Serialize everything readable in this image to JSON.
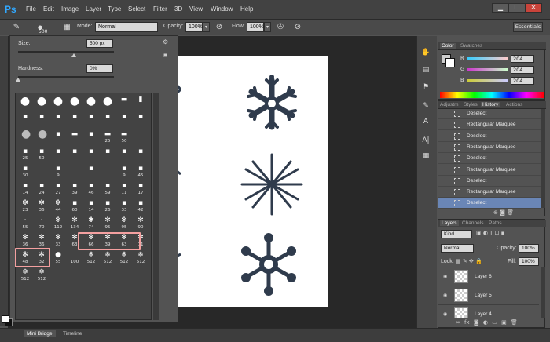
{
  "menu": {
    "logo": "Ps",
    "items": [
      "File",
      "Edit",
      "Image",
      "Layer",
      "Type",
      "Select",
      "Filter",
      "3D",
      "View",
      "Window",
      "Help"
    ],
    "window_buttons": [
      "▁",
      "☐",
      "✕"
    ]
  },
  "options": {
    "brush_size": "500",
    "mode_label": "Mode:",
    "mode_value": "Normal",
    "opacity_label": "Opacity:",
    "opacity_value": "100%",
    "flow_label": "Flow:",
    "flow_value": "100%",
    "workspace": "Essentials"
  },
  "brush_panel": {
    "size_label": "Size:",
    "size_value": "500 px",
    "hardness_label": "Hardness:",
    "hardness_value": "0%",
    "size_fraction": 0.58,
    "hardness_fraction": 0.0,
    "presets": [
      {
        "tip": "●",
        "num": ""
      },
      {
        "tip": "●",
        "num": ""
      },
      {
        "tip": "●",
        "num": ""
      },
      {
        "tip": "●",
        "num": ""
      },
      {
        "tip": "●",
        "num": ""
      },
      {
        "tip": "●",
        "num": ""
      },
      {
        "tip": "▬",
        "num": ""
      },
      {
        "tip": "▮",
        "num": ""
      },
      {
        "tip": "▪",
        "num": ""
      },
      {
        "tip": "▪",
        "num": ""
      },
      {
        "tip": "▪",
        "num": ""
      },
      {
        "tip": "▪",
        "num": ""
      },
      {
        "tip": "▪",
        "num": ""
      },
      {
        "tip": "▪",
        "num": ""
      },
      {
        "tip": "▪",
        "num": ""
      },
      {
        "tip": "▪",
        "num": ""
      },
      {
        "tip": "●",
        "num": ""
      },
      {
        "tip": "●",
        "num": ""
      },
      {
        "tip": "▪",
        "num": ""
      },
      {
        "tip": "▬",
        "num": ""
      },
      {
        "tip": "▪",
        "num": ""
      },
      {
        "tip": "▬",
        "num": "25"
      },
      {
        "tip": "▬",
        "num": "50"
      },
      {
        "tip": "",
        "num": ""
      },
      {
        "tip": "▪",
        "num": "25"
      },
      {
        "tip": "▪",
        "num": "50"
      },
      {
        "tip": "▪",
        "num": ""
      },
      {
        "tip": "▪",
        "num": ""
      },
      {
        "tip": "▪",
        "num": ""
      },
      {
        "tip": "▪",
        "num": ""
      },
      {
        "tip": "▪",
        "num": ""
      },
      {
        "tip": "▪",
        "num": ""
      },
      {
        "tip": "▪",
        "num": "30"
      },
      {
        "tip": "",
        "num": ""
      },
      {
        "tip": "▪",
        "num": "9"
      },
      {
        "tip": "",
        "num": ""
      },
      {
        "tip": "▪",
        "num": ""
      },
      {
        "tip": "",
        "num": ""
      },
      {
        "tip": "▪",
        "num": "9"
      },
      {
        "tip": "▪",
        "num": "45"
      },
      {
        "tip": "▪",
        "num": "14"
      },
      {
        "tip": "▪",
        "num": "24"
      },
      {
        "tip": "▪",
        "num": "27"
      },
      {
        "tip": "▪",
        "num": "39"
      },
      {
        "tip": "▪",
        "num": "46"
      },
      {
        "tip": "▪",
        "num": "59"
      },
      {
        "tip": "▪",
        "num": "11"
      },
      {
        "tip": "▪",
        "num": "17"
      },
      {
        "tip": "✻",
        "num": "23"
      },
      {
        "tip": "✻",
        "num": "36"
      },
      {
        "tip": "✻",
        "num": "44"
      },
      {
        "tip": "▪",
        "num": "60"
      },
      {
        "tip": "▪",
        "num": "14"
      },
      {
        "tip": "▪",
        "num": "26"
      },
      {
        "tip": "▪",
        "num": "33"
      },
      {
        "tip": "▪",
        "num": "42"
      },
      {
        "tip": "·",
        "num": "55"
      },
      {
        "tip": "·",
        "num": "70"
      },
      {
        "tip": "✻",
        "num": "112"
      },
      {
        "tip": "✻",
        "num": "134"
      },
      {
        "tip": "✱",
        "num": "74"
      },
      {
        "tip": "✻",
        "num": "95"
      },
      {
        "tip": "✻",
        "num": "95"
      },
      {
        "tip": "✻",
        "num": "90"
      },
      {
        "tip": "✻",
        "num": "36"
      },
      {
        "tip": "✻",
        "num": "36"
      },
      {
        "tip": "✻",
        "num": "33"
      },
      {
        "tip": "✻",
        "num": "63"
      },
      {
        "tip": "✻",
        "num": "66"
      },
      {
        "tip": "✻",
        "num": "39"
      },
      {
        "tip": "✻",
        "num": "63"
      },
      {
        "tip": "✻",
        "num": "11"
      },
      {
        "tip": "✻",
        "num": "48"
      },
      {
        "tip": "✻",
        "num": "32"
      },
      {
        "tip": "●",
        "num": "55"
      },
      {
        "tip": "",
        "num": "100"
      },
      {
        "tip": "❄",
        "num": "512"
      },
      {
        "tip": "❄",
        "num": "512"
      },
      {
        "tip": "❄",
        "num": "512"
      },
      {
        "tip": "❄",
        "num": "512"
      },
      {
        "tip": "❄",
        "num": "512"
      },
      {
        "tip": "❄",
        "num": "512"
      }
    ]
  },
  "color_panel": {
    "tabs": [
      "Color",
      "Swatches"
    ],
    "r_label": "R",
    "r_value": "204",
    "g_label": "G",
    "g_value": "204",
    "b_label": "B",
    "b_value": "204"
  },
  "history_panel": {
    "tabs": [
      "Adjustm",
      "Styles",
      "History",
      "Actions"
    ],
    "items": [
      "Deselect",
      "Rectangular Marquee",
      "Deselect",
      "Rectangular Marquee",
      "Deselect",
      "Rectangular Marquee",
      "Deselect",
      "Rectangular Marquee",
      "Deselect"
    ],
    "selected_index": 8
  },
  "layers_panel": {
    "tabs": [
      "Layers",
      "Channels",
      "Paths"
    ],
    "kind_label": "Kind",
    "blend_mode": "Normal",
    "opacity_label": "Opacity:",
    "opacity_value": "100%",
    "lock_label": "Lock:",
    "fill_label": "Fill:",
    "fill_value": "100%",
    "layers": [
      "Layer 6",
      "Layer 5",
      "Layer 4"
    ]
  },
  "bottom": {
    "tabs": [
      "Mini Bridge",
      "Timeline"
    ]
  },
  "icons": [
    "brush-icon",
    "gear-icon",
    "eye-icon",
    "lock-icon",
    "trash-icon",
    "new-layer-icon",
    "snowflake-icon"
  ]
}
